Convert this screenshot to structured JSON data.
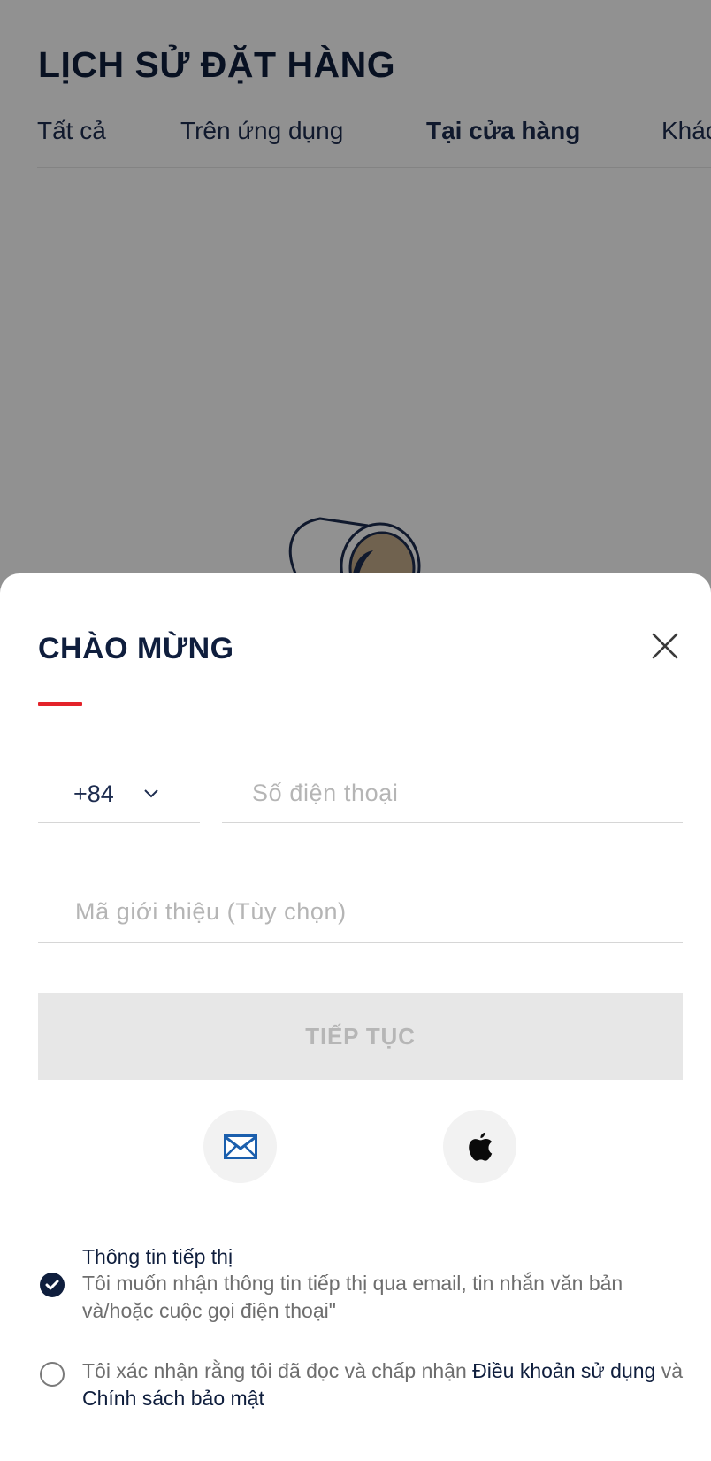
{
  "background_page": {
    "title": "LỊCH SỬ ĐẶT HÀNG",
    "tabs": [
      {
        "label": "Tất cả",
        "active": false
      },
      {
        "label": "Trên ứng dụng",
        "active": false
      },
      {
        "label": "Tại cửa hàng",
        "active": true
      },
      {
        "label": "Khác",
        "active": false
      }
    ]
  },
  "sheet": {
    "title": "CHÀO MỪNG",
    "close_icon": "close-icon",
    "accent_color": "#e3222a",
    "country_code": "+84",
    "phone_placeholder": "Số điện thoại",
    "referral_placeholder": "Mã giới thiệu (Tùy chọn)",
    "continue_label": "TIẾP TỤC",
    "social": [
      {
        "name": "email",
        "icon": "mail-icon"
      },
      {
        "name": "apple",
        "icon": "apple-icon"
      }
    ],
    "marketing": {
      "title": "Thông tin tiếp thị",
      "text": "Tôi muốn nhận thông tin tiếp thị qua email, tin nhắn văn bản và/hoặc cuộc gọi điện thoại\"",
      "checked": true
    },
    "terms": {
      "prefix": "Tôi xác nhận rằng tôi đã đọc và chấp nhận ",
      "terms_link": "Điều khoản sử dụng",
      "conjunction": " và ",
      "privacy_link": "Chính sách bảo mật",
      "checked": false
    }
  },
  "colors": {
    "navy": "#0f1e3d",
    "accent_red": "#e3222a",
    "mail_blue": "#1b5fad",
    "disabled_button": "#e7e7e7"
  }
}
